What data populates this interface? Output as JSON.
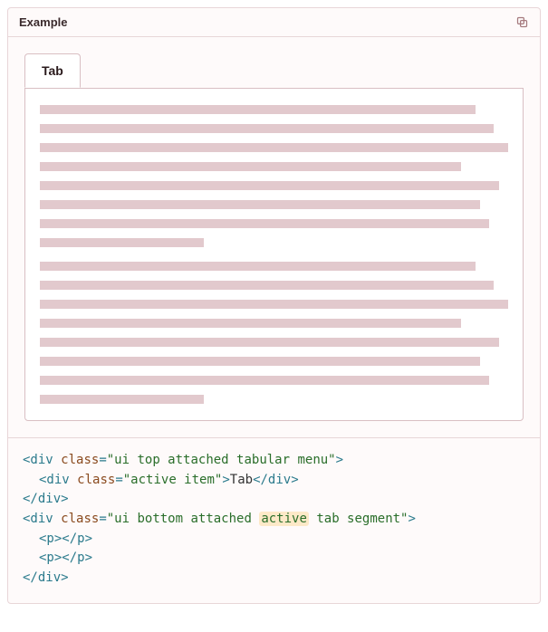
{
  "panel": {
    "title": "Example"
  },
  "tabs": {
    "items": [
      {
        "label": "Tab"
      }
    ]
  },
  "placeholder": {
    "paragraphs": [
      {
        "lines": [
          93,
          97,
          100,
          90,
          98,
          94,
          96,
          35
        ]
      },
      {
        "lines": [
          93,
          97,
          100,
          90,
          98,
          94,
          96,
          35
        ]
      }
    ]
  },
  "code": {
    "line1_open": "<div ",
    "line1_attr": "class",
    "line1_val": "\"ui top attached tabular menu\"",
    "line1_close": ">",
    "line2_open": "<div ",
    "line2_attr": "class",
    "line2_val": "\"active item\"",
    "line2_close": ">",
    "line2_text": "Tab",
    "line2_end": "</div>",
    "line3": "</div>",
    "line4_open": "<div ",
    "line4_attr": "class",
    "line4_val_pre": "\"ui bottom attached ",
    "line4_val_hl": "active",
    "line4_val_post": " tab segment\"",
    "line4_close": ">",
    "line5": "<p></p>",
    "line6": "<p></p>",
    "line7": "</div>"
  }
}
